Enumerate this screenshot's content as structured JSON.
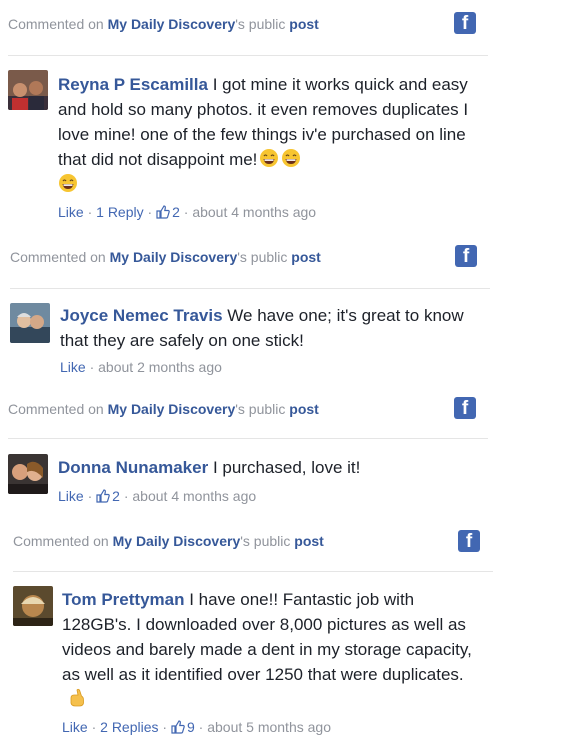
{
  "colors": {
    "link": "#365899",
    "meta": "#90949c",
    "facebook": "#4267b2"
  },
  "comments": [
    {
      "context": {
        "prefix": "Commented on ",
        "page": "My Daily Discovery",
        "suffix": "'s public ",
        "post": "post"
      },
      "author": "Reyna P Escamilla",
      "text": "I got mine it works quick and easy and hold so many photos. it even removes duplicates I love mine! one of the few things iv'e purchased on line that did not disappoint me!",
      "emojis": [
        "grinning-face-emoji",
        "grinning-face-emoji",
        "grinning-face-emoji"
      ],
      "like": "Like",
      "replies": "1 Reply",
      "likes": "2",
      "time": "about 4 months ago"
    },
    {
      "context": {
        "prefix": "Commented on ",
        "page": "My Daily Discovery",
        "suffix": "'s public ",
        "post": "post"
      },
      "author": "Joyce Nemec Travis",
      "text": "We have one; it's great to know that they are safely on one stick!",
      "like": "Like",
      "time": "about 2 months ago"
    },
    {
      "context": {
        "prefix": "Commented on ",
        "page": "My Daily Discovery",
        "suffix": "'s public ",
        "post": "post"
      },
      "author": "Donna Nunamaker",
      "text": "I purchased, love it!",
      "like": "Like",
      "likes": "2",
      "time": "about 4 months ago"
    },
    {
      "context": {
        "prefix": "Commented on ",
        "page": "My Daily Discovery",
        "suffix": "'s public ",
        "post": "post"
      },
      "author": "Tom Prettyman",
      "text": "I have one!! Fantastic job with 128GB's. I downloaded over 8,000 pictures as well as videos and barely made a dent in my storage capacity, as well as it identified over 1250 that were duplicates.",
      "emojis": [
        "pointing-hand-emoji"
      ],
      "like": "Like",
      "replies": "2 Replies",
      "likes": "9",
      "time": "about 5 months ago"
    }
  ],
  "sep": " · ",
  "fb_letter": "f"
}
